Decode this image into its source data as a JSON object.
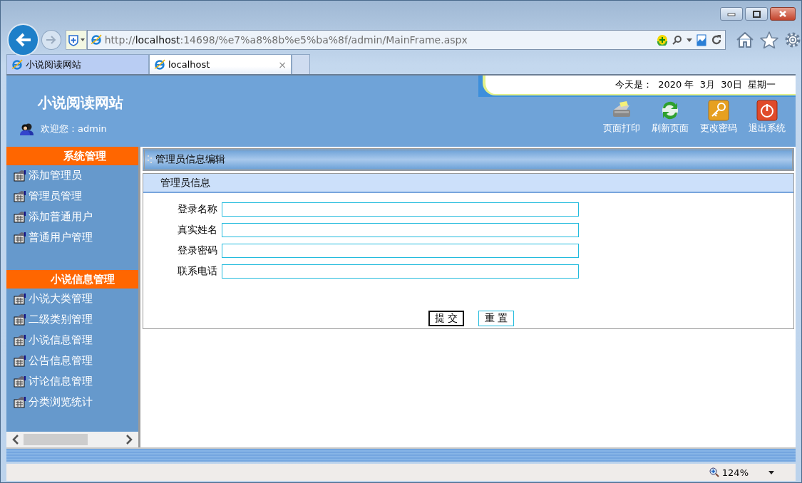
{
  "browser": {
    "address": "http://**localhost**:14698/%e7%a8%8b%e5%ba%8f/admin/MainFrame.aspx",
    "tabs": [
      {
        "label": "小说阅读网站",
        "selected": false
      },
      {
        "label": "localhost",
        "selected": true,
        "close": "×"
      }
    ],
    "zoom": "124%"
  },
  "header": {
    "site_title": "小说阅读网站",
    "welcome": "欢迎您：admin",
    "date_label": "今天是：",
    "date": "2020 年  3月  30日  星期一",
    "toolbar": [
      {
        "label": "页面打印",
        "kind": "print"
      },
      {
        "label": "刷新页面",
        "kind": "refresh"
      },
      {
        "label": "更改密码",
        "kind": "key"
      },
      {
        "label": "退出系统",
        "kind": "power"
      }
    ]
  },
  "sidebar": {
    "sections": [
      {
        "title": "系统管理",
        "items": [
          "添加管理员",
          "管理员管理",
          "添加普通用户",
          "普通用户管理"
        ]
      },
      {
        "title": "小说信息管理",
        "items": [
          "小说大类管理",
          "二级类别管理",
          "小说信息管理",
          "公告信息管理",
          "讨论信息管理",
          "分类浏览统计"
        ]
      }
    ]
  },
  "content": {
    "breadcrumb": "管理员信息编辑",
    "panel_title": "管理员信息",
    "fields": [
      {
        "label": "登录名称"
      },
      {
        "label": "真实姓名"
      },
      {
        "label": "登录密码"
      },
      {
        "label": "联系电话"
      }
    ],
    "buttons": [
      {
        "label": "提 交",
        "kind": "submit"
      },
      {
        "label": "重 置",
        "kind": "reset"
      }
    ]
  }
}
